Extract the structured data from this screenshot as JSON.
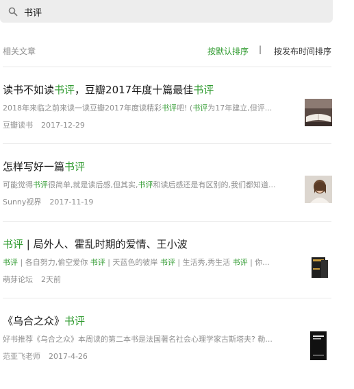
{
  "search": {
    "query": "书评"
  },
  "header": {
    "title": "相关文章",
    "sort_default": "按默认排序",
    "separator": "|",
    "sort_time": "按发布时间排序"
  },
  "articles": [
    {
      "title_pre": "读书不如读",
      "title_hl": "书评",
      "title_mid": "，豆瓣2017年度十篇最佳",
      "title_hl2": "书评",
      "snip_1": "2018年来临之前来读一读豆瓣2017年度读精彩",
      "snip_hl1": "书评",
      "snip_2": "吧! (",
      "snip_hl2": "书评",
      "snip_3": "为17年建立,但评...",
      "source": "豆瓣读书",
      "date": "2017-12-29"
    },
    {
      "title_pre": "怎样写好一篇",
      "title_hl": "书评",
      "snip_1": "可能觉得",
      "snip_hl1": "书评",
      "snip_2": "很简单,就是读后感,但其实,",
      "snip_hl2": "书评",
      "snip_3": "和读后感还是有区别的,我们都知道...",
      "source": "Sunny视界",
      "date": "2017-11-19"
    },
    {
      "title_hl": "书评",
      "title_post": " | 局外人、霍乱时期的爱情、王小波",
      "snip_hl1": "书评",
      "snip_1": " | 各自努力,偷空爱你 ",
      "snip_hl2": "书评",
      "snip_2": " | 天蓝色的彼岸 ",
      "snip_hl3": "书评",
      "snip_3": " | 生活秀,秀生活 ",
      "snip_hl4": "书评",
      "snip_4": " | 你...",
      "source": "萌芽论坛",
      "date": "2天前"
    },
    {
      "title_pre": "《乌合之众》",
      "title_hl": "书评",
      "snip_1": "好书推荐《乌合之众》本周读的第二本书是法国著名社会心理学家古斯塔夫? 勒...",
      "source": "范亚飞老师",
      "date": "2017-4-26"
    }
  ],
  "colors": {
    "highlight": "#2e9a2e",
    "muted": "#8f8f8f",
    "search_bg": "#ededed"
  }
}
